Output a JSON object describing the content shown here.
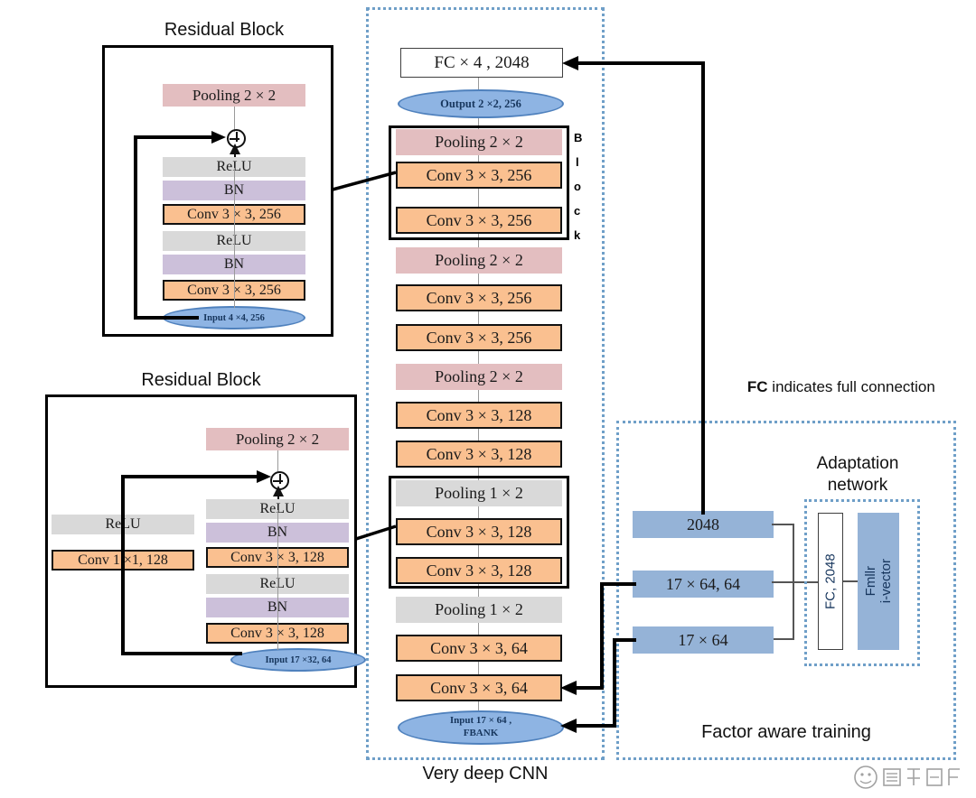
{
  "diagram": {
    "captions": {
      "very_deep_cnn": "Very deep CNN",
      "factor_aware_training": "Factor aware training",
      "adaptation_network_line1": "Adaptation",
      "adaptation_network_line2": "network",
      "residual_block_top": "Residual Block",
      "residual_block_bottom": "Residual Block",
      "fc_note_bold": "FC",
      "fc_note_rest": " indicates full connection",
      "block_letters": [
        "B",
        "l",
        "o",
        "c",
        "k"
      ]
    },
    "cnn_stack": [
      {
        "id": "fc4",
        "label": "FC × 4 , 2048",
        "kind": "fc"
      },
      {
        "id": "out-ell",
        "label": "Output 2 ×2, 256",
        "kind": "ellipse"
      },
      {
        "id": "pool1",
        "label": "Pooling 2 × 2",
        "kind": "pool-pink"
      },
      {
        "id": "conv1",
        "label": "Conv 3 × 3, 256",
        "kind": "conv"
      },
      {
        "id": "conv2",
        "label": "Conv 3 × 3, 256",
        "kind": "conv"
      },
      {
        "id": "pool2",
        "label": "Pooling 2 × 2",
        "kind": "pool-pink"
      },
      {
        "id": "conv3",
        "label": "Conv 3 × 3, 256",
        "kind": "conv"
      },
      {
        "id": "conv4",
        "label": "Conv 3 × 3, 256",
        "kind": "conv"
      },
      {
        "id": "pool3",
        "label": "Pooling 2 × 2",
        "kind": "pool-pink"
      },
      {
        "id": "conv5",
        "label": "Conv 3 × 3, 128",
        "kind": "conv"
      },
      {
        "id": "conv6",
        "label": "Conv 3 × 3, 128",
        "kind": "conv"
      },
      {
        "id": "pool4",
        "label": "Pooling 1 × 2",
        "kind": "pool-grey"
      },
      {
        "id": "conv7",
        "label": "Conv 3 × 3, 128",
        "kind": "conv"
      },
      {
        "id": "conv8",
        "label": "Conv 3 × 3, 128",
        "kind": "conv"
      },
      {
        "id": "pool5",
        "label": "Pooling 1 × 2",
        "kind": "pool-grey"
      },
      {
        "id": "conv9",
        "label": "Conv 3 × 3, 64",
        "kind": "conv"
      },
      {
        "id": "conv10",
        "label": "Conv 3 × 3, 64",
        "kind": "conv"
      },
      {
        "id": "in-ell",
        "label": "Input 17 × 64 ,",
        "label2": "FBANK",
        "kind": "ellipse"
      }
    ],
    "residual_top": {
      "pooling": "Pooling 2 × 2",
      "relu_upper": "ReLU",
      "bn_upper": "BN",
      "conv_upper": "Conv 3 × 3, 256",
      "relu_lower": "ReLU",
      "bn_lower": "BN",
      "conv_lower": "Conv 3 × 3, 256",
      "input": "Input 4 ×4, 256"
    },
    "residual_bottom": {
      "pooling": "Pooling 2 × 2",
      "relu_shortcut": "ReLU",
      "conv_shortcut": "Conv 1 ×1, 128",
      "relu_upper": "ReLU",
      "bn_upper": "BN",
      "conv_upper": "Conv 3 × 3, 128",
      "relu_lower": "ReLU",
      "bn_lower": "BN",
      "conv_lower": "Conv 3 × 3, 128",
      "input": "Input 17 ×32, 64"
    },
    "factor_aware": {
      "bars": [
        {
          "id": "fa-2048",
          "label": "2048"
        },
        {
          "id": "fa-1764-64",
          "label": "17 × 64, 64"
        },
        {
          "id": "fa-1764",
          "label": "17 × 64"
        }
      ],
      "adaptation": {
        "fc": "FC, 2048",
        "fmllr_line1": "Fmllr",
        "fmllr_line2": "i-vector"
      }
    },
    "colors": {
      "conv": "#fac090",
      "pool_pink": "#e3bec0",
      "pool_grey": "#d9d9d9",
      "bn": "#ccc0da",
      "relu": "#d9d9d9",
      "blue_bar": "#95b3d7",
      "ellipse": "#8eb4e3",
      "dotted_border": "#6f9fc8"
    }
  }
}
